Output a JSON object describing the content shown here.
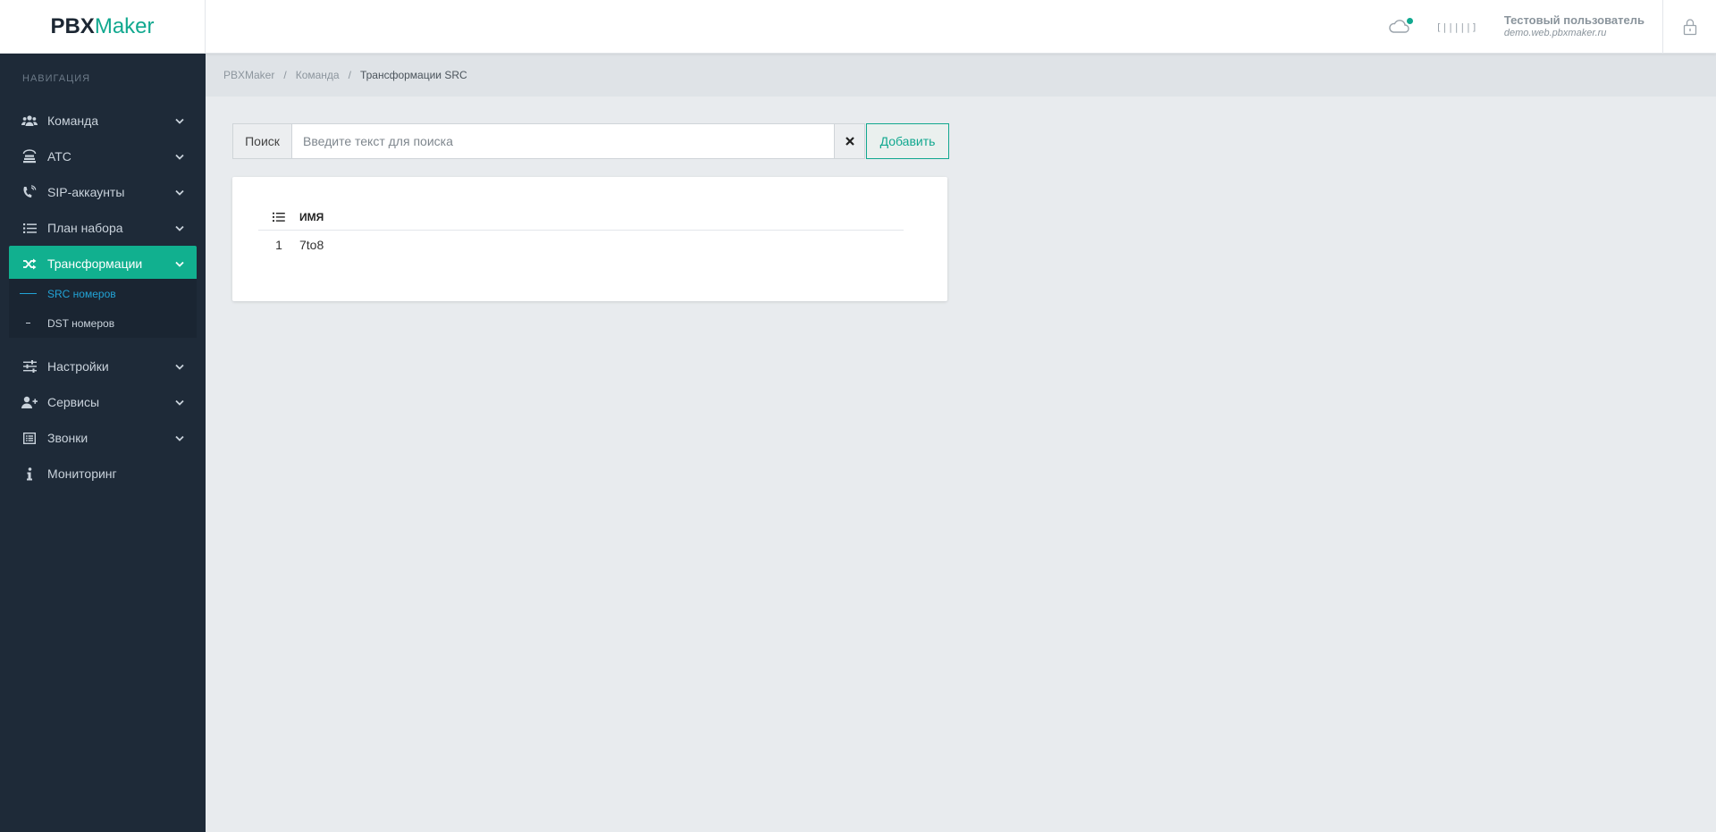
{
  "header": {
    "logo_part1": "PBX",
    "logo_part2": "Maker",
    "user_name": "Тестовый пользователь",
    "user_domain": "demo.web.pbxmaker.ru",
    "barcode_text": "[|||||]"
  },
  "sidebar": {
    "nav_label": "НАВИГАЦИЯ",
    "items": [
      {
        "label": "Команда",
        "icon": "users-icon"
      },
      {
        "label": "АТС",
        "icon": "server-icon"
      },
      {
        "label": "SIP-аккаунты",
        "icon": "phone-volume-icon"
      },
      {
        "label": "План набора",
        "icon": "list-icon"
      },
      {
        "label": "Трансформации",
        "icon": "shuffle-icon",
        "active": true
      },
      {
        "label": "Настройки",
        "icon": "sliders-icon"
      },
      {
        "label": "Сервисы",
        "icon": "user-plus-icon"
      },
      {
        "label": "Звонки",
        "icon": "list-alt-icon"
      },
      {
        "label": "Мониторинг",
        "icon": "info-icon"
      }
    ],
    "subitems": [
      {
        "label": "SRC номеров",
        "active": true
      },
      {
        "label": "DST номеров"
      }
    ]
  },
  "breadcrumb": [
    "PBXMaker",
    "Команда",
    "Трансформации SRC"
  ],
  "search": {
    "label": "Поиск",
    "placeholder": "Введите текст для поиска",
    "value": "",
    "add_label": "Добавить"
  },
  "table": {
    "header_name": "ИМЯ",
    "rows": [
      {
        "num": "1",
        "name": "7to8"
      }
    ]
  },
  "colors": {
    "accent": "#11b08f",
    "sidebar_bg": "#1e2a38",
    "sub_active": "#22a3d6"
  }
}
